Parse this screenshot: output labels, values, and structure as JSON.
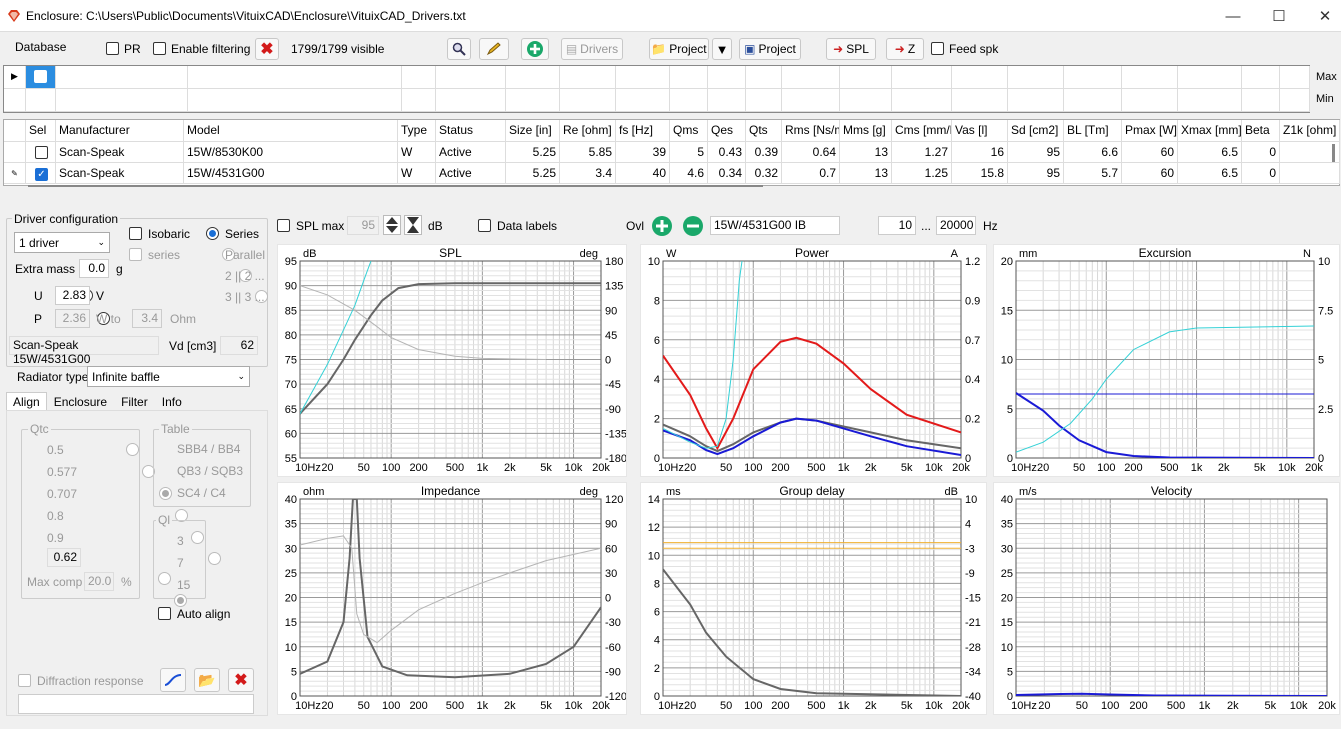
{
  "window": {
    "title": "Enclosure: C:\\Users\\Public\\Documents\\VituixCAD\\Enclosure\\VituixCAD_Drivers.txt"
  },
  "toolbar": {
    "database": "Database",
    "pr": "PR",
    "enable_filtering": "Enable filtering",
    "visible": "1799/1799 visible",
    "drivers": "Drivers",
    "project1": "Project",
    "project2": "Project",
    "spl": "SPL",
    "z": "Z",
    "feed_spk": "Feed spk"
  },
  "filter": {
    "max": "Max",
    "min": "Min"
  },
  "table": {
    "headers": [
      "Sel",
      "Manufacturer",
      "Model",
      "Type",
      "Status",
      "Size [in]",
      "Re [ohm]",
      "fs [Hz]",
      "Qms",
      "Qes",
      "Qts",
      "Rms [Ns/m]",
      "Mms [g]",
      "Cms [mm/N]",
      "Vas [l]",
      "Sd [cm2]",
      "BL [Tm]",
      "Pmax [W]",
      "Xmax [mm]",
      "Beta",
      "Z1k [ohm]"
    ],
    "rows": [
      [
        "",
        "Scan-Speak",
        "15W/8530K00",
        "W",
        "Active",
        "5.25",
        "5.85",
        "39",
        "5",
        "0.43",
        "0.39",
        "0.64",
        "13",
        "1.27",
        "16",
        "95",
        "6.6",
        "60",
        "6.5",
        "0",
        ""
      ],
      [
        "",
        "Scan-Speak",
        "15W/4531G00",
        "W",
        "Active",
        "5.25",
        "3.4",
        "40",
        "4.6",
        "0.34",
        "0.32",
        "0.7",
        "13",
        "1.25",
        "15.8",
        "95",
        "5.7",
        "60",
        "6.5",
        "0",
        ""
      ]
    ]
  },
  "driver_config": {
    "title": "Driver configuration",
    "drivers": "1 driver",
    "isobaric": "Isobaric",
    "series": "Series",
    "series2": "series",
    "parallel": "Parallel",
    "opt2": "2 || 2 ...",
    "opt3": "3 || 3 ...",
    "extra_mass_label": "Extra mass",
    "extra_mass": "0.0",
    "g": "g",
    "u_label": "U",
    "u_value": "2.83",
    "v": "V",
    "p_label": "P",
    "p_value": "2.36",
    "w_to": "W to",
    "ohm_value": "3.4",
    "ohm": "Ohm",
    "driver_name": "Scan-Speak 15W/4531G00",
    "vd_label": "Vd [cm3]",
    "vd_value": "62",
    "radiator_type_label": "Radiator type",
    "radiator_type": "Infinite baffle"
  },
  "tabs": [
    "Align",
    "Enclosure",
    "Filter",
    "Info"
  ],
  "align": {
    "qtc_title": "Qtc",
    "qtc": [
      "0.5",
      "0.577",
      "0.707",
      "0.8",
      "0.9"
    ],
    "qtc_custom": "0.62",
    "max_comp_label": "Max comp",
    "max_comp": "20.0",
    "pct": "%",
    "table_title": "Table",
    "table": [
      "SBB4 / BB4",
      "QB3 / SQB3",
      "SC4 / C4"
    ],
    "ql_title": "Ql",
    "ql": [
      "3",
      "7",
      "15"
    ],
    "auto_align": "Auto align",
    "diffraction": "Diffraction response"
  },
  "chart_controls": {
    "spl_max": "SPL max",
    "spl_max_value": "95",
    "db": "dB",
    "data_labels": "Data labels",
    "ovl": "Ovl",
    "ovl_name": "15W/4531G00 IB",
    "f_from": "10",
    "ellipsis": "...",
    "f_to": "20000",
    "hz": "Hz"
  },
  "colors": {
    "accent": "#1a6fd6",
    "gray": "#666666",
    "cyan": "#33d1d6",
    "red": "#e31a1a",
    "blue": "#1a1ad6",
    "orange": "#f0b030"
  },
  "chart_data": [
    {
      "type": "line",
      "title": "SPL",
      "ylabel": "dB",
      "y2label": "deg",
      "x_ticks": [
        "10Hz",
        "20",
        "50",
        "100",
        "200",
        "500",
        "1k",
        "2k",
        "5k",
        "10k",
        "20k"
      ],
      "y_ticks": [
        "95",
        "90",
        "85",
        "80",
        "75",
        "70",
        "65",
        "60",
        "55"
      ],
      "y2_ticks": [
        "180",
        "135",
        "90",
        "45",
        "0",
        "-45",
        "-90",
        "-135",
        "-180"
      ],
      "ylim": [
        55,
        95
      ],
      "y2lim": [
        -180,
        180
      ],
      "series": [
        {
          "color": "gray",
          "width": 2,
          "points": [
            [
              10,
              64
            ],
            [
              20,
              70
            ],
            [
              30,
              75
            ],
            [
              40,
              79
            ],
            [
              60,
              84
            ],
            [
              80,
              87
            ],
            [
              120,
              89.5
            ],
            [
              200,
              90.3
            ],
            [
              500,
              90.5
            ],
            [
              20000,
              90.5
            ]
          ]
        },
        {
          "color": "cyan",
          "width": 1,
          "points": [
            [
              10,
              64
            ],
            [
              20,
              74
            ],
            [
              30,
              81
            ],
            [
              40,
              86
            ],
            [
              50,
              91
            ],
            [
              60,
              95
            ]
          ]
        },
        {
          "color": "lightgray",
          "width": 1,
          "axis": 2,
          "points": [
            [
              10,
              135
            ],
            [
              20,
              118
            ],
            [
              40,
              90
            ],
            [
              70,
              60
            ],
            [
              100,
              40
            ],
            [
              200,
              18
            ],
            [
              500,
              6
            ],
            [
              1000,
              2
            ],
            [
              5000,
              0
            ]
          ]
        }
      ]
    },
    {
      "type": "line",
      "title": "Power",
      "ylabel": "W",
      "y2label": "A",
      "x_ticks": [
        "10Hz",
        "20",
        "50",
        "100",
        "200",
        "500",
        "1k",
        "2k",
        "5k",
        "10k",
        "20k"
      ],
      "y_ticks": [
        "10",
        "8",
        "6",
        "4",
        "2",
        "0"
      ],
      "y2_ticks": [
        "1.2",
        "0.9",
        "0.7",
        "0.4",
        "0.2",
        "0"
      ],
      "ylim": [
        0,
        10
      ],
      "y2lim": [
        0,
        1.2
      ],
      "series": [
        {
          "color": "red",
          "width": 2,
          "points": [
            [
              10,
              5.2
            ],
            [
              20,
              3.2
            ],
            [
              30,
              1.5
            ],
            [
              40,
              0.5
            ],
            [
              60,
              2
            ],
            [
              100,
              4.5
            ],
            [
              200,
              5.9
            ],
            [
              300,
              6.1
            ],
            [
              500,
              5.8
            ],
            [
              1000,
              4.8
            ],
            [
              2000,
              3.5
            ],
            [
              5000,
              2.2
            ],
            [
              20000,
              1.3
            ]
          ]
        },
        {
          "color": "gray",
          "width": 2,
          "points": [
            [
              10,
              1.7
            ],
            [
              20,
              1.1
            ],
            [
              30,
              0.6
            ],
            [
              40,
              0.35
            ],
            [
              60,
              0.7
            ],
            [
              100,
              1.3
            ],
            [
              200,
              1.8
            ],
            [
              300,
              2.0
            ],
            [
              500,
              1.9
            ],
            [
              1000,
              1.6
            ],
            [
              2000,
              1.3
            ],
            [
              5000,
              0.9
            ],
            [
              20000,
              0.5
            ]
          ]
        },
        {
          "color": "blue",
          "width": 2,
          "points": [
            [
              10,
              1.4
            ],
            [
              20,
              0.9
            ],
            [
              30,
              0.4
            ],
            [
              40,
              0.2
            ],
            [
              60,
              0.5
            ],
            [
              100,
              1.1
            ],
            [
              200,
              1.8
            ],
            [
              300,
              2.0
            ],
            [
              500,
              1.9
            ],
            [
              1000,
              1.5
            ],
            [
              2000,
              1.1
            ],
            [
              5000,
              0.6
            ],
            [
              20000,
              0.15
            ]
          ]
        },
        {
          "color": "cyan",
          "width": 1,
          "points": [
            [
              10,
              1.5
            ],
            [
              20,
              0.8
            ],
            [
              30,
              0.5
            ],
            [
              40,
              0.6
            ],
            [
              50,
              2
            ],
            [
              60,
              5
            ],
            [
              70,
              9
            ],
            [
              75,
              10
            ]
          ]
        }
      ]
    },
    {
      "type": "line",
      "title": "Excursion",
      "ylabel": "mm",
      "y2label": "N",
      "x_ticks": [
        "10Hz",
        "20",
        "50",
        "100",
        "200",
        "500",
        "1k",
        "2k",
        "5k",
        "10k",
        "20k"
      ],
      "y_ticks": [
        "20",
        "15",
        "10",
        "5",
        "0"
      ],
      "y2_ticks": [
        "10",
        "7.5",
        "5",
        "2.5",
        "0"
      ],
      "ylim": [
        0,
        20
      ],
      "y2lim": [
        0,
        10
      ],
      "series": [
        {
          "color": "blue",
          "width": 2,
          "points": [
            [
              10,
              6.6
            ],
            [
              20,
              4.8
            ],
            [
              30,
              3.3
            ],
            [
              50,
              1.8
            ],
            [
              100,
              0.6
            ],
            [
              200,
              0.2
            ],
            [
              500,
              0.05
            ],
            [
              20000,
              0
            ]
          ]
        },
        {
          "color": "blue",
          "width": 1,
          "points": [
            [
              10,
              6.5
            ],
            [
              20000,
              6.5
            ]
          ]
        },
        {
          "color": "cyan",
          "width": 1,
          "points": [
            [
              10,
              0.6
            ],
            [
              20,
              1.6
            ],
            [
              40,
              3.5
            ],
            [
              70,
              6
            ],
            [
              100,
              8
            ],
            [
              200,
              11
            ],
            [
              500,
              12.8
            ],
            [
              1000,
              13.2
            ],
            [
              20000,
              13.4
            ]
          ]
        }
      ]
    },
    {
      "type": "line",
      "title": "Impedance",
      "ylabel": "ohm",
      "y2label": "deg",
      "x_ticks": [
        "10Hz",
        "20",
        "50",
        "100",
        "200",
        "500",
        "1k",
        "2k",
        "5k",
        "10k",
        "20k"
      ],
      "y_ticks": [
        "40",
        "35",
        "30",
        "25",
        "20",
        "15",
        "10",
        "5",
        "0"
      ],
      "y2_ticks": [
        "120",
        "90",
        "60",
        "30",
        "0",
        "-30",
        "-60",
        "-90",
        "-120"
      ],
      "ylim": [
        0,
        40
      ],
      "y2lim": [
        -120,
        120
      ],
      "series": [
        {
          "color": "gray",
          "width": 2,
          "points": [
            [
              10,
              4.5
            ],
            [
              20,
              7
            ],
            [
              30,
              15
            ],
            [
              35,
              28
            ],
            [
              38,
              40
            ],
            [
              42,
              40
            ],
            [
              45,
              28
            ],
            [
              55,
              12
            ],
            [
              80,
              6
            ],
            [
              150,
              4.2
            ],
            [
              500,
              3.8
            ],
            [
              2000,
              4.5
            ],
            [
              5000,
              6.5
            ],
            [
              10000,
              10
            ],
            [
              20000,
              18
            ]
          ]
        },
        {
          "color": "lightgray",
          "width": 1,
          "axis": 2,
          "points": [
            [
              10,
              64
            ],
            [
              20,
              72
            ],
            [
              30,
              75
            ],
            [
              37,
              60
            ],
            [
              42,
              -20
            ],
            [
              50,
              -45
            ],
            [
              70,
              -55
            ],
            [
              100,
              -40
            ],
            [
              200,
              -15
            ],
            [
              500,
              5
            ],
            [
              1000,
              18
            ],
            [
              2000,
              30
            ],
            [
              5000,
              45
            ],
            [
              20000,
              60
            ]
          ]
        }
      ]
    },
    {
      "type": "line",
      "title": "Group delay",
      "ylabel": "ms",
      "y2label": "dB",
      "x_ticks": [
        "10Hz",
        "20",
        "50",
        "100",
        "200",
        "500",
        "1k",
        "2k",
        "5k",
        "10k",
        "20k"
      ],
      "y_ticks": [
        "14",
        "12",
        "10",
        "8",
        "6",
        "4",
        "2",
        "0"
      ],
      "y2_ticks": [
        "10",
        "4",
        "-3",
        "-9",
        "-15",
        "-21",
        "-28",
        "-34",
        "-40"
      ],
      "ylim": [
        0,
        14
      ],
      "y2lim": [
        -40,
        10
      ],
      "series": [
        {
          "color": "gray",
          "width": 2,
          "points": [
            [
              10,
              9
            ],
            [
              20,
              6.5
            ],
            [
              30,
              4.5
            ],
            [
              50,
              2.8
            ],
            [
              100,
              1.2
            ],
            [
              200,
              0.5
            ],
            [
              500,
              0.2
            ],
            [
              20000,
              0
            ]
          ]
        },
        {
          "color": "orange",
          "width": 1,
          "points": [
            [
              10,
              10.9
            ],
            [
              20000,
              10.9
            ]
          ]
        },
        {
          "color": "orange",
          "width": 1,
          "points": [
            [
              10,
              10.5
            ],
            [
              20000,
              10.5
            ]
          ]
        }
      ]
    },
    {
      "type": "line",
      "title": "Velocity",
      "ylabel": "m/s",
      "x_ticks": [
        "10Hz",
        "20",
        "50",
        "100",
        "200",
        "500",
        "1k",
        "2k",
        "5k",
        "10k",
        "20k"
      ],
      "y_ticks": [
        "40",
        "35",
        "30",
        "25",
        "20",
        "15",
        "10",
        "5",
        "0"
      ],
      "ylim": [
        0,
        40
      ],
      "series": [
        {
          "color": "blue",
          "width": 2,
          "points": [
            [
              10,
              0.2
            ],
            [
              30,
              0.4
            ],
            [
              50,
              0.45
            ],
            [
              100,
              0.3
            ],
            [
              300,
              0.1
            ],
            [
              20000,
              0
            ]
          ]
        }
      ]
    }
  ]
}
